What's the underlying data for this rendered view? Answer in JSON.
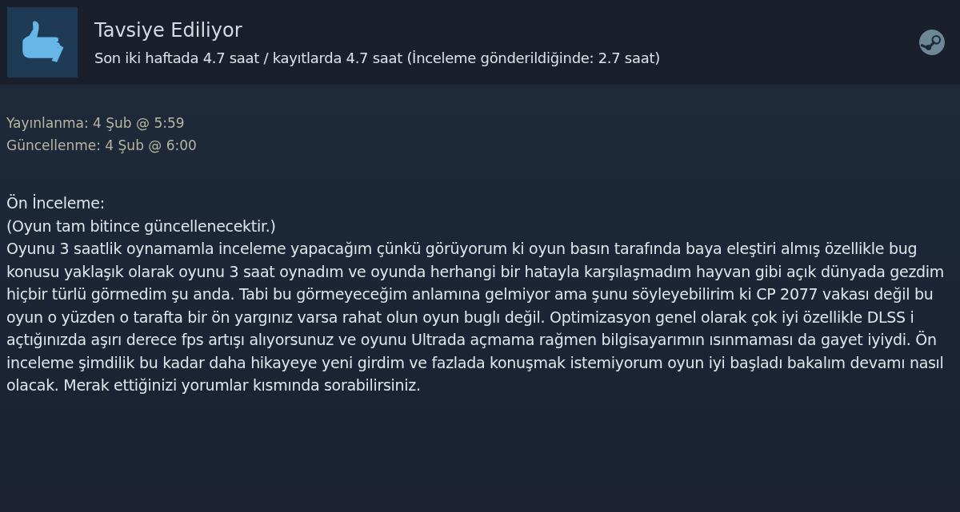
{
  "review": {
    "recommended": true,
    "verdict": "Tavsiye Ediliyor",
    "hours": "Son iki haftada 4.7 saat / kayıtlarda 4.7 saat (İnceleme gönderildiğinde: 2.7 saat)"
  },
  "dates": [
    "Yayınlanma: 4 Şub @ 5:59",
    "Güncellenme: 4 Şub @ 6:00"
  ],
  "body": [
    "Ön İnceleme:",
    "(Oyun tam bitince güncellenecektir.)",
    "Oyunu 3 saatlik oynamamla inceleme yapacağım çünkü görüyorum ki oyun basın tarafında baya eleştiri almış özellikle bug konusu yaklaşık olarak oyunu 3 saat oynadım ve oyunda herhangi bir hatayla karşılaşmadım hayvan gibi açık dünyada gezdim hiçbir türlü görmedim şu anda. Tabi bu görmeyeceğim anlamına gelmiyor ama şunu söyleyebilirim ki CP 2077 vakası değil bu oyun o yüzden o tarafta bir ön yargınız varsa rahat olun oyun buglı değil. Optimizasyon genel olarak çok iyi özellikle DLSS i açtığınızda aşırı derece fps artışı alıyorsunuz ve oyunu Ultrada açmama rağmen bilgisayarımın ısınmaması da gayet iyiydi. Ön inceleme şimdilik bu kadar daha hikayeye yeni girdim ve fazlada konuşmak istemiyorum oyun iyi başladı bakalım devamı nasıl olacak. Merak ettiğinizi yorumlar kısmında sorabilirsiniz."
  ]
}
